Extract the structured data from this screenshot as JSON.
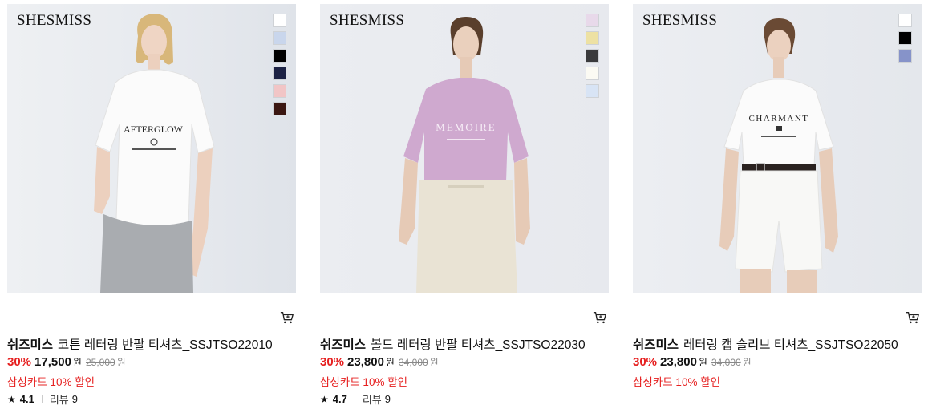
{
  "products": [
    {
      "brand_logo": "SHESMISS",
      "shirt_print": "AFTERGLOW",
      "swatches": [
        "#ffffff",
        "#c9d6ec",
        "#000000",
        "#1c2244",
        "#f1c5c6",
        "#3b1712"
      ],
      "brand": "쉬즈미스",
      "name": "코튼 레터링 반팔 티셔츠_SSJTSO22010",
      "discount": "30%",
      "price": "17,500",
      "price_unit": "원",
      "original_price": "25,000",
      "original_unit": "원",
      "promo": "삼성카드 10% 할인",
      "rating": "4.1",
      "review_label": "리뷰",
      "review_count": "9",
      "cart_icon": "cart-icon"
    },
    {
      "brand_logo": "SHESMISS",
      "shirt_print": "MEMOIRE",
      "swatches": [
        "#e8d9ea",
        "#ede1a3",
        "#3a3a3c",
        "#fbfaf3",
        "#d8e4f5"
      ],
      "brand": "쉬즈미스",
      "name": "볼드 레터링 반팔 티셔츠_SSJTSO22030",
      "discount": "30%",
      "price": "23,800",
      "price_unit": "원",
      "original_price": "34,000",
      "original_unit": "원",
      "promo": "삼성카드 10% 할인",
      "rating": "4.7",
      "review_label": "리뷰",
      "review_count": "9",
      "cart_icon": "cart-icon"
    },
    {
      "brand_logo": "SHESMISS",
      "shirt_print": "CHARMANT",
      "swatches": [
        "#ffffff",
        "#000000",
        "#8693c9"
      ],
      "brand": "쉬즈미스",
      "name": "레터링 캡 슬리브 티셔츠_SSJTSO22050",
      "discount": "30%",
      "price": "23,800",
      "price_unit": "원",
      "original_price": "34,000",
      "original_unit": "원",
      "promo": "삼성카드 10% 할인"
    }
  ],
  "colors": {
    "discount": "#e62020",
    "promo": "#e62020"
  }
}
